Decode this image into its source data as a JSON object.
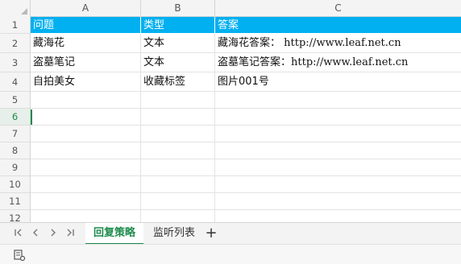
{
  "columns": [
    "A",
    "B",
    "C"
  ],
  "rows": [
    "1",
    "2",
    "3",
    "4",
    "5",
    "6",
    "7",
    "8",
    "9",
    "10",
    "11",
    "12",
    "13"
  ],
  "active_row": "6",
  "table": {
    "header": {
      "a": "问题",
      "b": "类型",
      "c": "答案"
    },
    "body": [
      {
        "a": "藏海花",
        "b": "文本",
        "c_prefix": "藏海花答案：",
        "c_url": "http://www.leaf.net.cn"
      },
      {
        "a": "盗墓笔记",
        "b": "文本",
        "c_prefix": "盗墓笔记答案：",
        "c_url": "http://www.leaf.net.cn"
      },
      {
        "a": "自拍美女",
        "b": "收藏标签",
        "c_prefix": "图片001号",
        "c_url": ""
      }
    ]
  },
  "sheet_tabs": {
    "nav": [
      "|<",
      "<",
      ">",
      ">|"
    ],
    "tabs": [
      "回复策略",
      "监听列表"
    ],
    "active": "回复策略",
    "add": "+"
  },
  "colors": {
    "header_fill": "#00b0f0",
    "accent": "#1e8a4c"
  },
  "icons": {
    "status": "macro-record-icon"
  }
}
